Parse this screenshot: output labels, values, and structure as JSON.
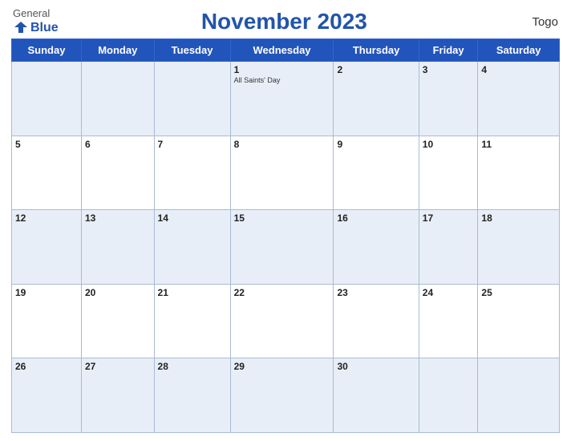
{
  "header": {
    "logo_general": "General",
    "logo_blue": "Blue",
    "title": "November 2023",
    "country": "Togo"
  },
  "days_of_week": [
    "Sunday",
    "Monday",
    "Tuesday",
    "Wednesday",
    "Thursday",
    "Friday",
    "Saturday"
  ],
  "weeks": [
    [
      {
        "day": "",
        "event": ""
      },
      {
        "day": "",
        "event": ""
      },
      {
        "day": "",
        "event": ""
      },
      {
        "day": "1",
        "event": "All Saints' Day"
      },
      {
        "day": "2",
        "event": ""
      },
      {
        "day": "3",
        "event": ""
      },
      {
        "day": "4",
        "event": ""
      }
    ],
    [
      {
        "day": "5",
        "event": ""
      },
      {
        "day": "6",
        "event": ""
      },
      {
        "day": "7",
        "event": ""
      },
      {
        "day": "8",
        "event": ""
      },
      {
        "day": "9",
        "event": ""
      },
      {
        "day": "10",
        "event": ""
      },
      {
        "day": "11",
        "event": ""
      }
    ],
    [
      {
        "day": "12",
        "event": ""
      },
      {
        "day": "13",
        "event": ""
      },
      {
        "day": "14",
        "event": ""
      },
      {
        "day": "15",
        "event": ""
      },
      {
        "day": "16",
        "event": ""
      },
      {
        "day": "17",
        "event": ""
      },
      {
        "day": "18",
        "event": ""
      }
    ],
    [
      {
        "day": "19",
        "event": ""
      },
      {
        "day": "20",
        "event": ""
      },
      {
        "day": "21",
        "event": ""
      },
      {
        "day": "22",
        "event": ""
      },
      {
        "day": "23",
        "event": ""
      },
      {
        "day": "24",
        "event": ""
      },
      {
        "day": "25",
        "event": ""
      }
    ],
    [
      {
        "day": "26",
        "event": ""
      },
      {
        "day": "27",
        "event": ""
      },
      {
        "day": "28",
        "event": ""
      },
      {
        "day": "29",
        "event": ""
      },
      {
        "day": "30",
        "event": ""
      },
      {
        "day": "",
        "event": ""
      },
      {
        "day": "",
        "event": ""
      }
    ]
  ],
  "colors": {
    "header_bg": "#2255bb",
    "accent": "#2255aa",
    "row_odd_bg": "#e8eef7",
    "row_even_bg": "#ffffff",
    "border": "#aabbd4"
  }
}
